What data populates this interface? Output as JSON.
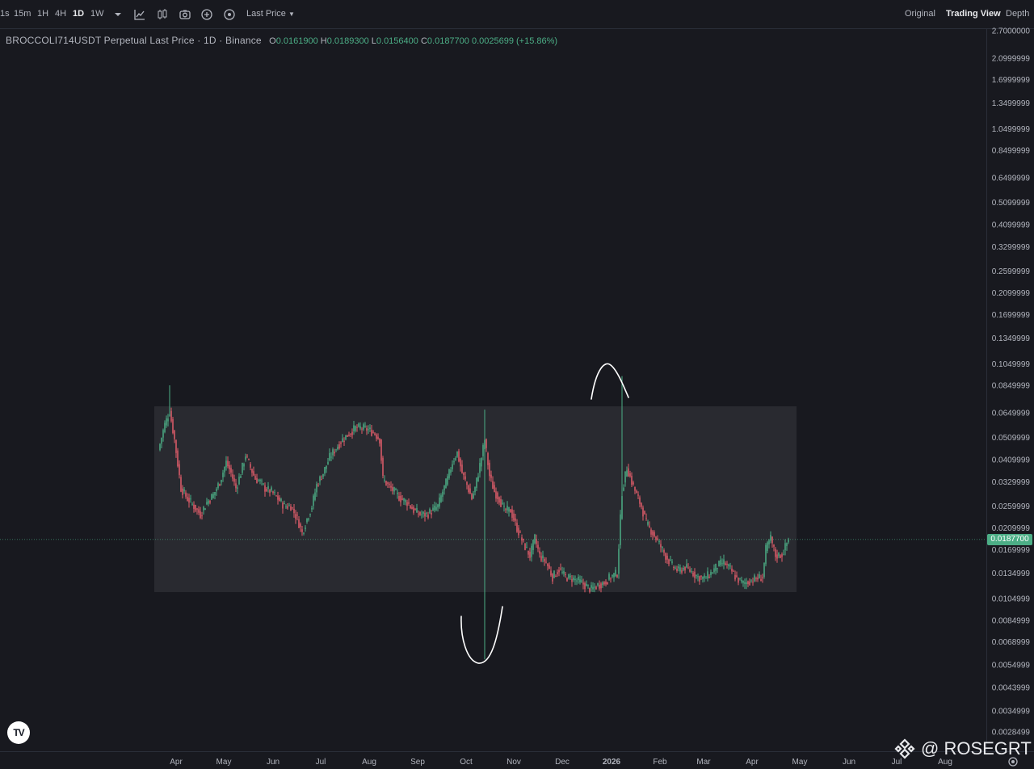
{
  "toolbar": {
    "intervals": [
      "1s",
      "15m",
      "1H",
      "4H",
      "1D",
      "1W"
    ],
    "active_interval": "1D",
    "price_source": "Last Price",
    "views": [
      "Original",
      "Trading View",
      "Depth"
    ],
    "active_view": "Trading View"
  },
  "legend": {
    "symbol": "BROCCOLI714USDT Perpetual Last Price · 1D · Binance",
    "o_label": "O",
    "o": "0.0161900",
    "h_label": "H",
    "h": "0.0189300",
    "l_label": "L",
    "l": "0.0156400",
    "c_label": "C",
    "c": "0.0187700",
    "change": "0.0025699 (+15.86%)"
  },
  "current_price": "0.0187700",
  "watermark": "@ ROSEGRT",
  "colors": {
    "background": "#18191f",
    "up": "#4cae86",
    "down": "#e35d6a",
    "range_box": "#2a2b31"
  },
  "chart_data": {
    "type": "candlestick",
    "scale": "log",
    "y_ticks": [
      "2.7000000",
      "2.0999999",
      "1.6999999",
      "1.3499999",
      "1.0499999",
      "0.8499999",
      "0.6499999",
      "0.5099999",
      "0.4099999",
      "0.3299999",
      "0.2599999",
      "0.2099999",
      "0.1699999",
      "0.1349999",
      "0.1049999",
      "0.0849999",
      "0.0649999",
      "0.0509999",
      "0.0409999",
      "0.0329999",
      "0.0259999",
      "0.0209999",
      "0.0169999",
      "0.0134999",
      "0.0104999",
      "0.0084999",
      "0.0068999",
      "0.0054999",
      "0.0043999",
      "0.0034999",
      "0.0028499"
    ],
    "x_ticks": [
      "Apr",
      "May",
      "Jun",
      "Jul",
      "Aug",
      "Sep",
      "Oct",
      "Nov",
      "Dec",
      "2026",
      "Feb",
      "Mar",
      "Apr",
      "May",
      "Jun",
      "Jul",
      "Aug"
    ],
    "price_path": [
      [
        0,
        0.045
      ],
      [
        4,
        0.058
      ],
      [
        7,
        0.066
      ],
      [
        10,
        0.05
      ],
      [
        14,
        0.031
      ],
      [
        18,
        0.028
      ],
      [
        22,
        0.026
      ],
      [
        26,
        0.024
      ],
      [
        30,
        0.027
      ],
      [
        34,
        0.029
      ],
      [
        38,
        0.033
      ],
      [
        42,
        0.04
      ],
      [
        45,
        0.036
      ],
      [
        48,
        0.031
      ],
      [
        51,
        0.036
      ],
      [
        54,
        0.043
      ],
      [
        57,
        0.038
      ],
      [
        60,
        0.034
      ],
      [
        63,
        0.033
      ],
      [
        66,
        0.031
      ],
      [
        70,
        0.03
      ],
      [
        74,
        0.028
      ],
      [
        78,
        0.026
      ],
      [
        82,
        0.026
      ],
      [
        86,
        0.023
      ],
      [
        89,
        0.02
      ],
      [
        92,
        0.023
      ],
      [
        95,
        0.026
      ],
      [
        98,
        0.032
      ],
      [
        102,
        0.036
      ],
      [
        106,
        0.042
      ],
      [
        110,
        0.046
      ],
      [
        114,
        0.05
      ],
      [
        118,
        0.053
      ],
      [
        122,
        0.056
      ],
      [
        126,
        0.056
      ],
      [
        130,
        0.055
      ],
      [
        134,
        0.053
      ],
      [
        137,
        0.05
      ],
      [
        139,
        0.034
      ],
      [
        142,
        0.032
      ],
      [
        146,
        0.03
      ],
      [
        150,
        0.028
      ],
      [
        154,
        0.027
      ],
      [
        158,
        0.025
      ],
      [
        162,
        0.024
      ],
      [
        166,
        0.024
      ],
      [
        170,
        0.025
      ],
      [
        173,
        0.026
      ],
      [
        176,
        0.03
      ],
      [
        179,
        0.034
      ],
      [
        182,
        0.04
      ],
      [
        185,
        0.044
      ],
      [
        188,
        0.036
      ],
      [
        191,
        0.032
      ],
      [
        194,
        0.028
      ],
      [
        196,
        0.031
      ],
      [
        198,
        0.036
      ],
      [
        200,
        0.042
      ],
      [
        202,
        0.05
      ],
      [
        205,
        0.035
      ],
      [
        208,
        0.03
      ],
      [
        211,
        0.028
      ],
      [
        214,
        0.025
      ],
      [
        218,
        0.025
      ],
      [
        222,
        0.021
      ],
      [
        226,
        0.018
      ],
      [
        230,
        0.016
      ],
      [
        233,
        0.019
      ],
      [
        236,
        0.016
      ],
      [
        240,
        0.015
      ],
      [
        244,
        0.013
      ],
      [
        248,
        0.014
      ],
      [
        252,
        0.013
      ],
      [
        256,
        0.0128
      ],
      [
        260,
        0.0125
      ],
      [
        264,
        0.012
      ],
      [
        268,
        0.0115
      ],
      [
        272,
        0.012
      ],
      [
        276,
        0.0123
      ],
      [
        280,
        0.013
      ],
      [
        284,
        0.0135
      ],
      [
        287,
        0.03
      ],
      [
        290,
        0.038
      ],
      [
        293,
        0.033
      ],
      [
        296,
        0.029
      ],
      [
        299,
        0.026
      ],
      [
        302,
        0.022
      ],
      [
        306,
        0.02
      ],
      [
        310,
        0.018
      ],
      [
        314,
        0.016
      ],
      [
        318,
        0.0145
      ],
      [
        322,
        0.0138
      ],
      [
        326,
        0.0143
      ],
      [
        330,
        0.0137
      ],
      [
        334,
        0.013
      ],
      [
        338,
        0.0128
      ],
      [
        342,
        0.0135
      ],
      [
        346,
        0.0145
      ],
      [
        350,
        0.015
      ],
      [
        354,
        0.014
      ],
      [
        358,
        0.0128
      ],
      [
        362,
        0.0122
      ],
      [
        366,
        0.0125
      ],
      [
        370,
        0.0128
      ],
      [
        374,
        0.013
      ],
      [
        376,
        0.017
      ],
      [
        379,
        0.019
      ],
      [
        382,
        0.016
      ],
      [
        386,
        0.0162
      ],
      [
        390,
        0.0188
      ]
    ],
    "spikes": [
      {
        "day": 7,
        "high": 0.085
      },
      {
        "day": 202,
        "high": 0.067,
        "low": 0.0058
      },
      {
        "day": 287,
        "high": 0.093
      }
    ]
  }
}
